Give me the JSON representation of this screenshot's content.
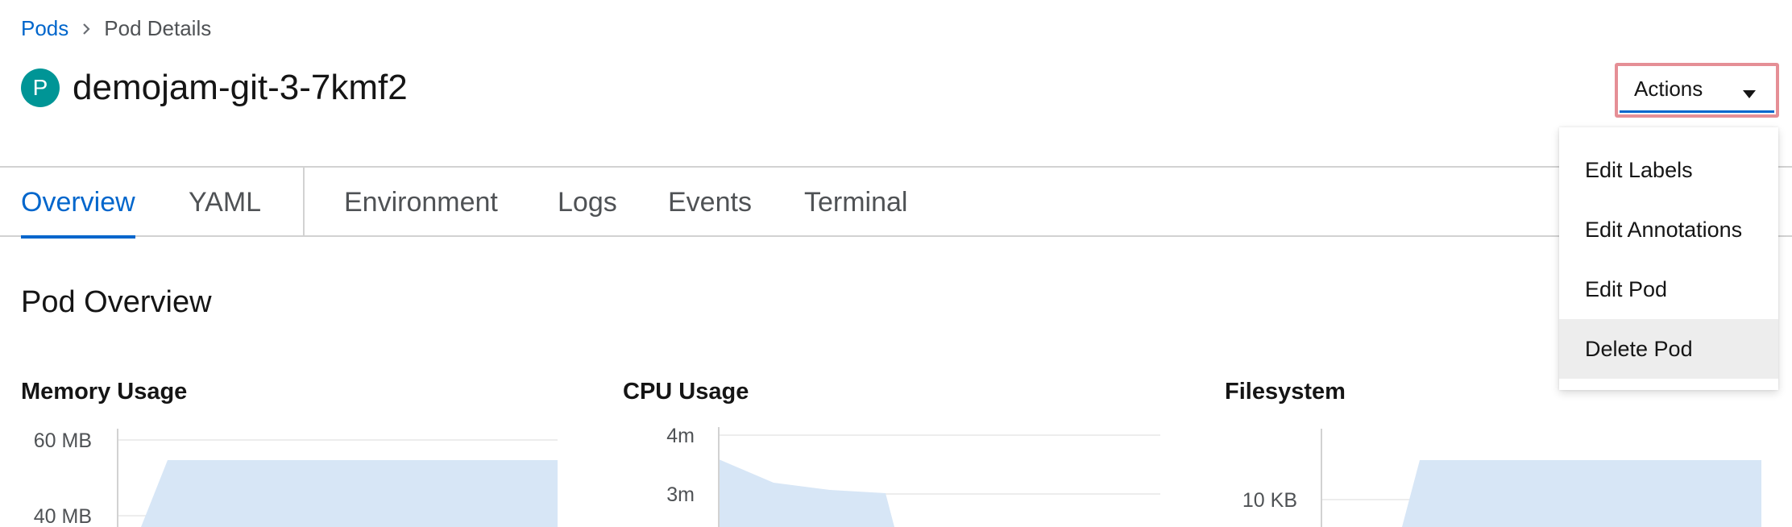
{
  "breadcrumb": {
    "parent": "Pods",
    "current": "Pod Details"
  },
  "pod": {
    "badge": "P",
    "name": "demojam-git-3-7kmf2"
  },
  "actions": {
    "label": "Actions"
  },
  "tabs": [
    {
      "label": "Overview"
    },
    {
      "label": "YAML"
    },
    {
      "label": "Environment"
    },
    {
      "label": "Logs"
    },
    {
      "label": "Events"
    },
    {
      "label": "Terminal"
    }
  ],
  "menu": {
    "items": [
      {
        "label": "Edit Labels"
      },
      {
        "label": "Edit Annotations"
      },
      {
        "label": "Edit Pod"
      },
      {
        "label": "Delete Pod"
      }
    ]
  },
  "section_title": "Pod Overview",
  "chart_data": [
    {
      "type": "area",
      "title": "Memory Usage",
      "y_ticks": [
        "60 MB",
        "40 MB"
      ]
    },
    {
      "type": "area",
      "title": "CPU Usage",
      "y_ticks": [
        "4m",
        "3m"
      ]
    },
    {
      "type": "area",
      "title": "Filesystem",
      "y_ticks": [
        "10 KB"
      ]
    }
  ],
  "colors": {
    "accent": "#0066cc",
    "badge": "#009596",
    "area_fill": "#d7e6f6"
  }
}
